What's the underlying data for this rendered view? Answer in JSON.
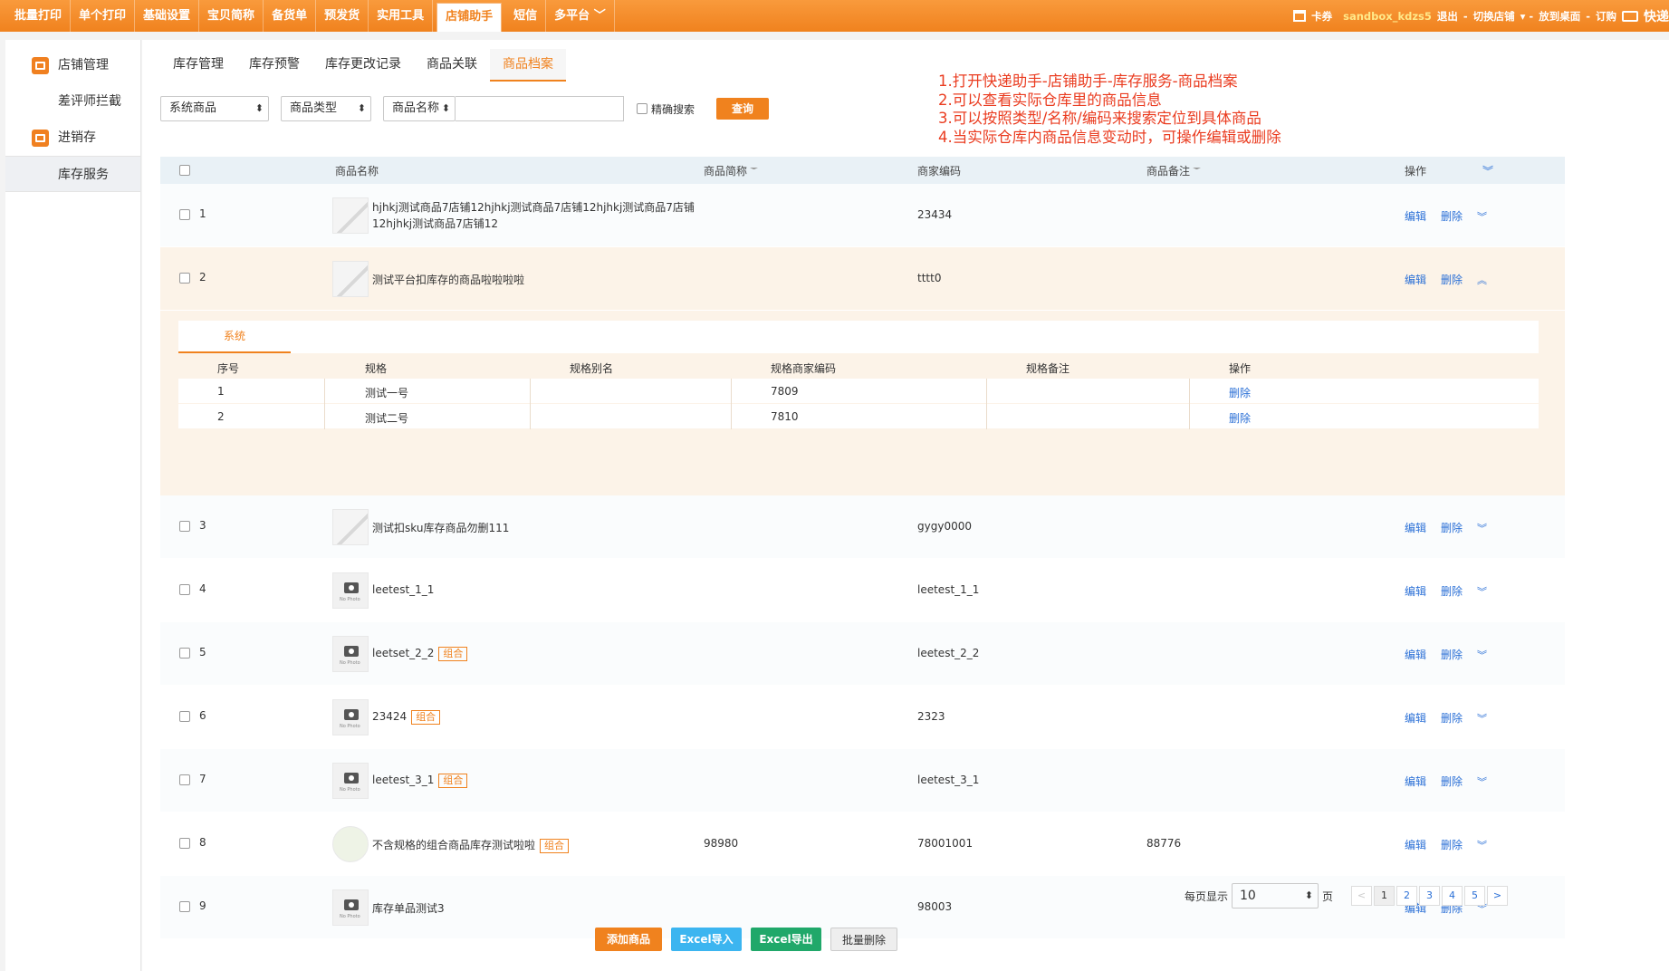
{
  "topnav": {
    "items": [
      "批量打印",
      "单个打印",
      "基础设置",
      "宝贝简称",
      "备货单",
      "预发货",
      "实用工具",
      "店铺助手",
      "短信",
      "多平台"
    ],
    "active_index": 7,
    "right": {
      "coupon": "卡券",
      "user": "sandbox_kdzs5",
      "logout": "退出",
      "switch_shop": "切换店铺",
      "desktop": "放到桌面",
      "order": "订购",
      "brand": "快递"
    }
  },
  "sidebar": {
    "items": [
      {
        "label": "店铺管理",
        "icon": "store-icon"
      },
      {
        "label": "差评师拦截"
      },
      {
        "label": "进销存",
        "icon": "inventory-icon"
      },
      {
        "label": "库存服务",
        "active": true
      }
    ]
  },
  "tabs": [
    "库存管理",
    "库存预警",
    "库存更改记录",
    "商品关联",
    "商品档案"
  ],
  "active_tab": 4,
  "filters": {
    "type1": "系统商品",
    "type2": "商品类型",
    "type3": "商品名称",
    "exact": "精确搜索",
    "search_btn": "查询"
  },
  "notes": [
    "1.打开快递助手-店铺助手-库存服务-商品档案",
    "2.可以查看实际仓库里的商品信息",
    "3.可以按照类型/名称/编码来搜索定位到具体商品",
    "4.当实际仓库内商品信息变动时，可操作编辑或删除"
  ],
  "table": {
    "headers": {
      "name": "商品名称",
      "abbr": "商品简称",
      "code": "商家编码",
      "note": "商品备注",
      "ops": "操作"
    },
    "edit_label": "编辑",
    "delete_label": "删除",
    "tag_label": "组合",
    "rows": [
      {
        "idx": "1",
        "name": "hjhkj测试商品7店铺12hjhkj测试商品7店铺12hjhkj测试商品7店铺12hjhkj测试商品7店铺12",
        "abbr": "",
        "code": "23434",
        "note": "",
        "pic": "image"
      },
      {
        "idx": "2",
        "name": "测试平台扣库存的商品啦啦啦啦",
        "abbr": "",
        "code": "tttt0",
        "note": "",
        "pic": "image"
      },
      {
        "idx": "3",
        "name": "测试扣sku库存商品勿删111",
        "abbr": "",
        "code": "gygy0000",
        "note": "",
        "pic": "image"
      },
      {
        "idx": "4",
        "name": "leetest_1_1",
        "abbr": "",
        "code": "leetest_1_1",
        "note": "",
        "pic": "none"
      },
      {
        "idx": "5",
        "name": "leetset_2_2",
        "abbr": "",
        "code": "leetest_2_2",
        "note": "",
        "pic": "none",
        "tag": true
      },
      {
        "idx": "6",
        "name": "23424",
        "abbr": "",
        "code": "2323",
        "note": "",
        "pic": "none",
        "tag": true
      },
      {
        "idx": "7",
        "name": "leetest_3_1",
        "abbr": "",
        "code": "leetest_3_1",
        "note": "",
        "pic": "none",
        "tag": true
      },
      {
        "idx": "8",
        "name": "不含规格的组合商品库存测试啦啦",
        "abbr": "98980",
        "code": "78001001",
        "note": "88776",
        "pic": "face",
        "tag": true
      },
      {
        "idx": "9",
        "name": "库存单品测试3",
        "abbr": "",
        "code": "98003",
        "note": "",
        "pic": "none"
      }
    ],
    "no_photo": "No Photo",
    "expanded": {
      "sub_tab": "系统",
      "headers": {
        "idx": "序号",
        "spec": "规格",
        "alias": "规格别名",
        "code": "规格商家编码",
        "note": "规格备注",
        "ops": "操作"
      },
      "rows": [
        {
          "idx": "1",
          "spec": "测试一号",
          "alias": "",
          "code": "7809",
          "note": "",
          "op": "删除"
        },
        {
          "idx": "2",
          "spec": "测试二号",
          "alias": "",
          "code": "7810",
          "note": "",
          "op": "删除"
        }
      ]
    }
  },
  "pager": {
    "label": "每页显示",
    "size": "10",
    "unit": "页",
    "prev": "<",
    "pages": [
      "1",
      "2",
      "3",
      "4",
      "5"
    ],
    "next": ">",
    "current": "1"
  },
  "bottom_buttons": {
    "add": "添加商品",
    "import": "Excel导入",
    "export": "Excel导出",
    "batch_delete": "批量删除"
  }
}
